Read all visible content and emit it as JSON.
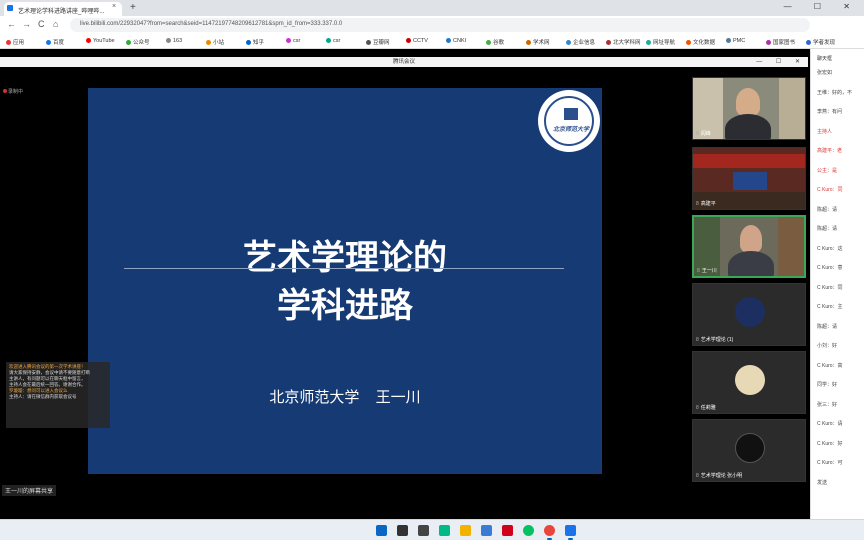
{
  "browser": {
    "tab_title": "艺术理论学科进路讲座_哔哩哔...",
    "tab_close": "×",
    "new_tab": "+",
    "window_controls": "— ☐ ✕",
    "nav_back": "←",
    "nav_forward": "→",
    "nav_reload": "C",
    "nav_home": "⌂",
    "address": "live.bilibili.com/22932047?from=search&seid=11472197748209612781&spm_id_from=333.337.0.0",
    "bookmarks": [
      "应用",
      "百度",
      "YouTube",
      "公众号",
      "163",
      "小站",
      "知乎",
      "csr",
      "csr",
      "豆瓣网",
      "CCTV",
      "CNKI",
      "谷歌",
      "学术网",
      "企业信息",
      "北大学科网",
      "网址导航",
      "文化数据",
      "PMC",
      "国家图书",
      "学者发现"
    ]
  },
  "meeting": {
    "window_title": "腾讯会议",
    "window_controls": "— ☐ ✕",
    "status": "录制中",
    "bottom_label": "王一川的屏幕共享"
  },
  "slide": {
    "title_line1": "艺术学理论的",
    "title_line2": "学科进路",
    "author": "北京师范大学 王一川",
    "logo_text": "北京师范大学"
  },
  "chat_overlay": {
    "line1": "欢迎进入腾讯会议的第一次学术讲座！",
    "line2": "请大家保持安静，会议中请不要随意打断",
    "line3": "主讲人，有问题可以在聊天框中留言，",
    "line4": "主持人会在最后统一回答。谢谢合作。",
    "line5": "罗璇璇：想问可以进入会议么",
    "line6": "主持人：请在微信群内获取会议号"
  },
  "participants": [
    {
      "name": "阎峰",
      "tag": "8"
    },
    {
      "name": "高建平",
      "tag": "8"
    },
    {
      "name": "王一川",
      "tag": "8"
    },
    {
      "name": "艺术学理论 (1)",
      "tag": "8"
    },
    {
      "name": "任莉雅",
      "tag": "8"
    },
    {
      "name": "艺术学理论 张小明",
      "tag": "8"
    }
  ],
  "side_chat": {
    "header": "聊天框",
    "lines": [
      "张宏如",
      "王维：好的，不",
      "李燕：有问",
      "主持人",
      "高建平：老",
      "公主：是",
      "C Kuro：同",
      "陈超：请",
      "陈超：请",
      "C Kuro：这",
      "C Kuro：意",
      "C Kuro：同",
      "C Kuro：主",
      "陈超：请",
      "小刘：好",
      "C Kuro：高",
      "同学：好",
      "张三：好",
      "C Kuro：请",
      "C Kuro：好",
      "C Kuro：可",
      "发送"
    ]
  },
  "taskbar": {
    "icons": [
      "start-icon",
      "search-icon",
      "taskview-icon",
      "widgets-icon",
      "explorer-icon",
      "store-icon",
      "netease-icon",
      "wechat-icon",
      "chrome-icon",
      "meeting-icon"
    ]
  }
}
